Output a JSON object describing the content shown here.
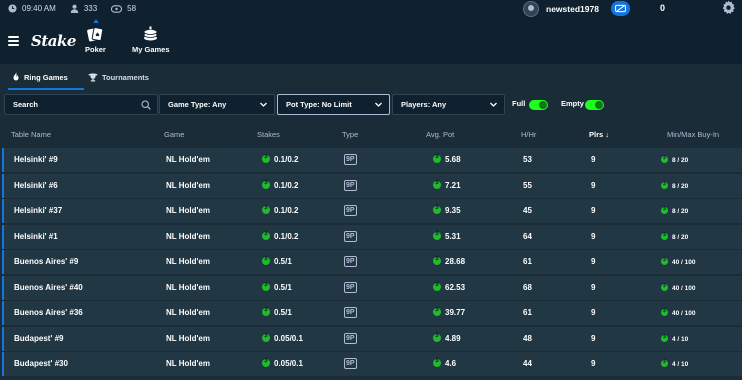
{
  "status": {
    "time": "09:40 AM",
    "users_online": "333",
    "games_count": "58"
  },
  "account": {
    "username": "newsted1978",
    "balance": "0"
  },
  "nav": {
    "logo": "Stake",
    "items": [
      {
        "label": "Poker"
      },
      {
        "label": "My Games"
      }
    ]
  },
  "tabs": {
    "ring": "Ring Games",
    "tournaments": "Tournaments"
  },
  "filters": {
    "search_value": "Search",
    "game_type": "Game Type: Any",
    "pot_type": "Pot Type: No Limit",
    "players": "Players: Any",
    "full_label": "Full",
    "empty_label": "Empty"
  },
  "columns": {
    "table_name": "Table Name",
    "game": "Game",
    "stakes": "Stakes",
    "type": "Type",
    "avg_pot": "Avg. Pot",
    "hhr": "H/Hr",
    "plrs": "Plrs ↓",
    "minmax": "Min/Max Buy-In"
  },
  "colors": {
    "accent": "#1475e1",
    "money_green": "#1fbb2a",
    "toggle_on": "#1fff20"
  },
  "rows": [
    {
      "name": "Helsinki' #9",
      "game": "NL Hold'em",
      "stakes": "0.1/0.2",
      "type": "9P",
      "avg_pot": "5.68",
      "hhr": "53",
      "plrs": "9",
      "minmax": "8 / 20"
    },
    {
      "name": "Helsinki' #6",
      "game": "NL Hold'em",
      "stakes": "0.1/0.2",
      "type": "9P",
      "avg_pot": "7.21",
      "hhr": "55",
      "plrs": "9",
      "minmax": "8 / 20"
    },
    {
      "name": "Helsinki' #37",
      "game": "NL Hold'em",
      "stakes": "0.1/0.2",
      "type": "9P",
      "avg_pot": "9.35",
      "hhr": "45",
      "plrs": "9",
      "minmax": "8 / 20"
    },
    {
      "name": "Helsinki' #1",
      "game": "NL Hold'em",
      "stakes": "0.1/0.2",
      "type": "9P",
      "avg_pot": "5.31",
      "hhr": "64",
      "plrs": "9",
      "minmax": "8 / 20"
    },
    {
      "name": "Buenos Aires' #9",
      "game": "NL Hold'em",
      "stakes": "0.5/1",
      "type": "9P",
      "avg_pot": "28.68",
      "hhr": "61",
      "plrs": "9",
      "minmax": "40 / 100"
    },
    {
      "name": "Buenos Aires' #40",
      "game": "NL Hold'em",
      "stakes": "0.5/1",
      "type": "9P",
      "avg_pot": "62.53",
      "hhr": "68",
      "plrs": "9",
      "minmax": "40 / 100"
    },
    {
      "name": "Buenos Aires' #36",
      "game": "NL Hold'em",
      "stakes": "0.5/1",
      "type": "9P",
      "avg_pot": "39.77",
      "hhr": "61",
      "plrs": "9",
      "minmax": "40 / 100"
    },
    {
      "name": "Budapest' #9",
      "game": "NL Hold'em",
      "stakes": "0.05/0.1",
      "type": "9P",
      "avg_pot": "4.89",
      "hhr": "48",
      "plrs": "9",
      "minmax": "4 / 10"
    },
    {
      "name": "Budapest' #30",
      "game": "NL Hold'em",
      "stakes": "0.05/0.1",
      "type": "9P",
      "avg_pot": "4.6",
      "hhr": "44",
      "plrs": "9",
      "minmax": "4 / 10"
    }
  ]
}
